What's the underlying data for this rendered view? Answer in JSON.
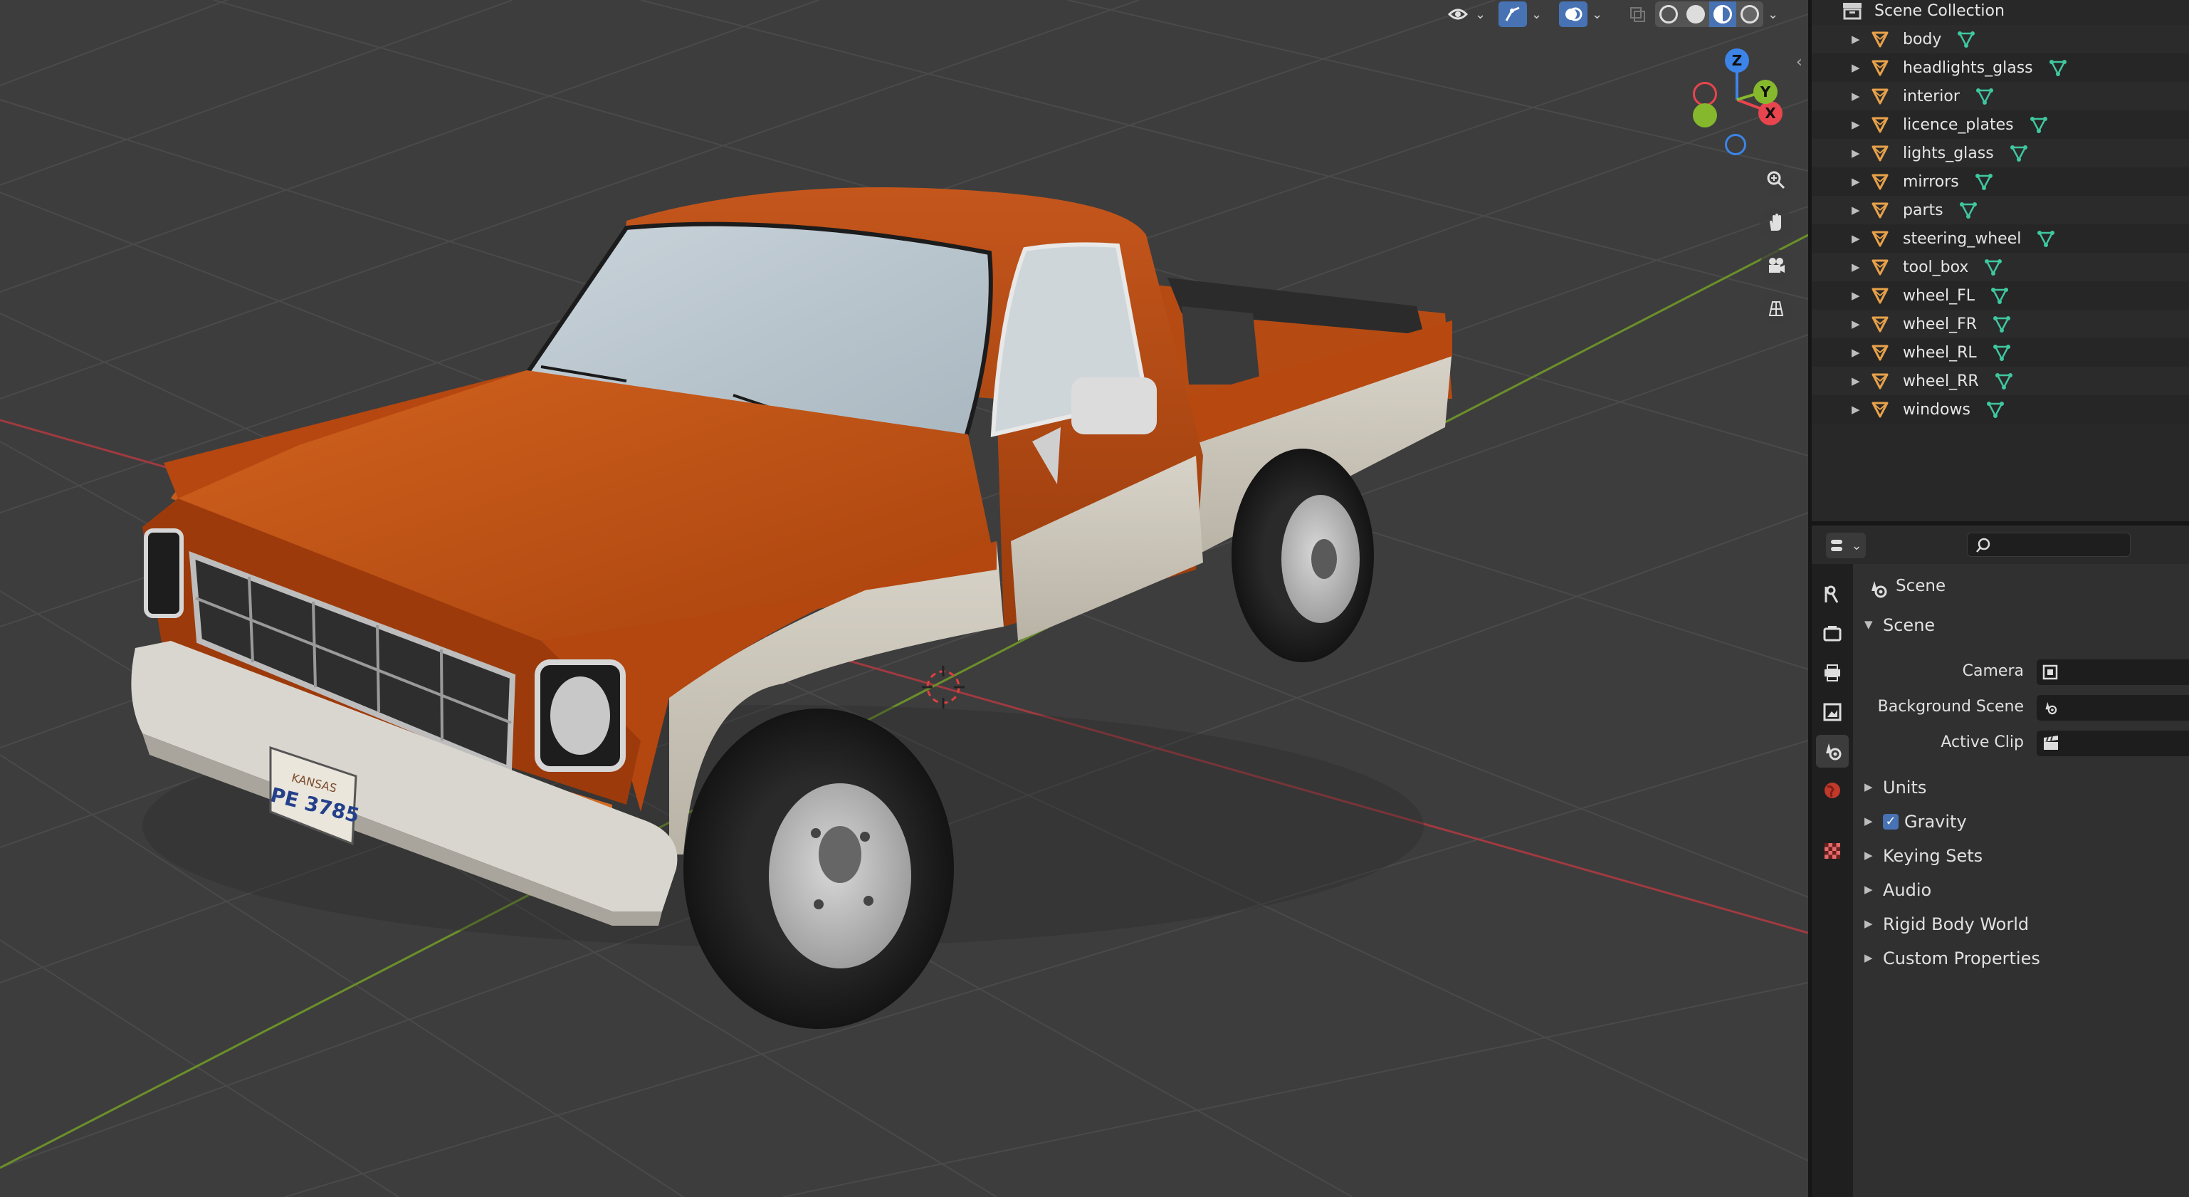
{
  "outliner": {
    "root_label": "Scene Collection",
    "items": [
      {
        "name": "body"
      },
      {
        "name": "headlights_glass"
      },
      {
        "name": "interior"
      },
      {
        "name": "licence_plates"
      },
      {
        "name": "lights_glass"
      },
      {
        "name": "mirrors"
      },
      {
        "name": "parts"
      },
      {
        "name": "steering_wheel"
      },
      {
        "name": "tool_box"
      },
      {
        "name": "wheel_FL"
      },
      {
        "name": "wheel_FR"
      },
      {
        "name": "wheel_RL"
      },
      {
        "name": "wheel_RR"
      },
      {
        "name": "windows"
      }
    ]
  },
  "viewport": {
    "gizmo": {
      "x": "X",
      "y": "Y",
      "z": "Z"
    },
    "plate_state": "KANSAS",
    "plate_number": "PE 3785"
  },
  "properties": {
    "context_title": "Scene",
    "panel_title": "Scene",
    "fields": [
      {
        "label": "Camera"
      },
      {
        "label": "Background Scene"
      },
      {
        "label": "Active Clip"
      }
    ],
    "panels": [
      {
        "label": "Units",
        "checkbox": false
      },
      {
        "label": "Gravity",
        "checkbox": true
      },
      {
        "label": "Keying Sets",
        "checkbox": false
      },
      {
        "label": "Audio",
        "checkbox": false
      },
      {
        "label": "Rigid Body World",
        "checkbox": false
      },
      {
        "label": "Custom Properties",
        "checkbox": false
      }
    ]
  },
  "colors": {
    "accent": "#4772b3",
    "mesh_orange": "#e8a14a",
    "mesh_data_teal": "#3fc79f",
    "axis_x": "#e8454e",
    "axis_y": "#86b82e",
    "axis_z": "#3c84e8"
  }
}
